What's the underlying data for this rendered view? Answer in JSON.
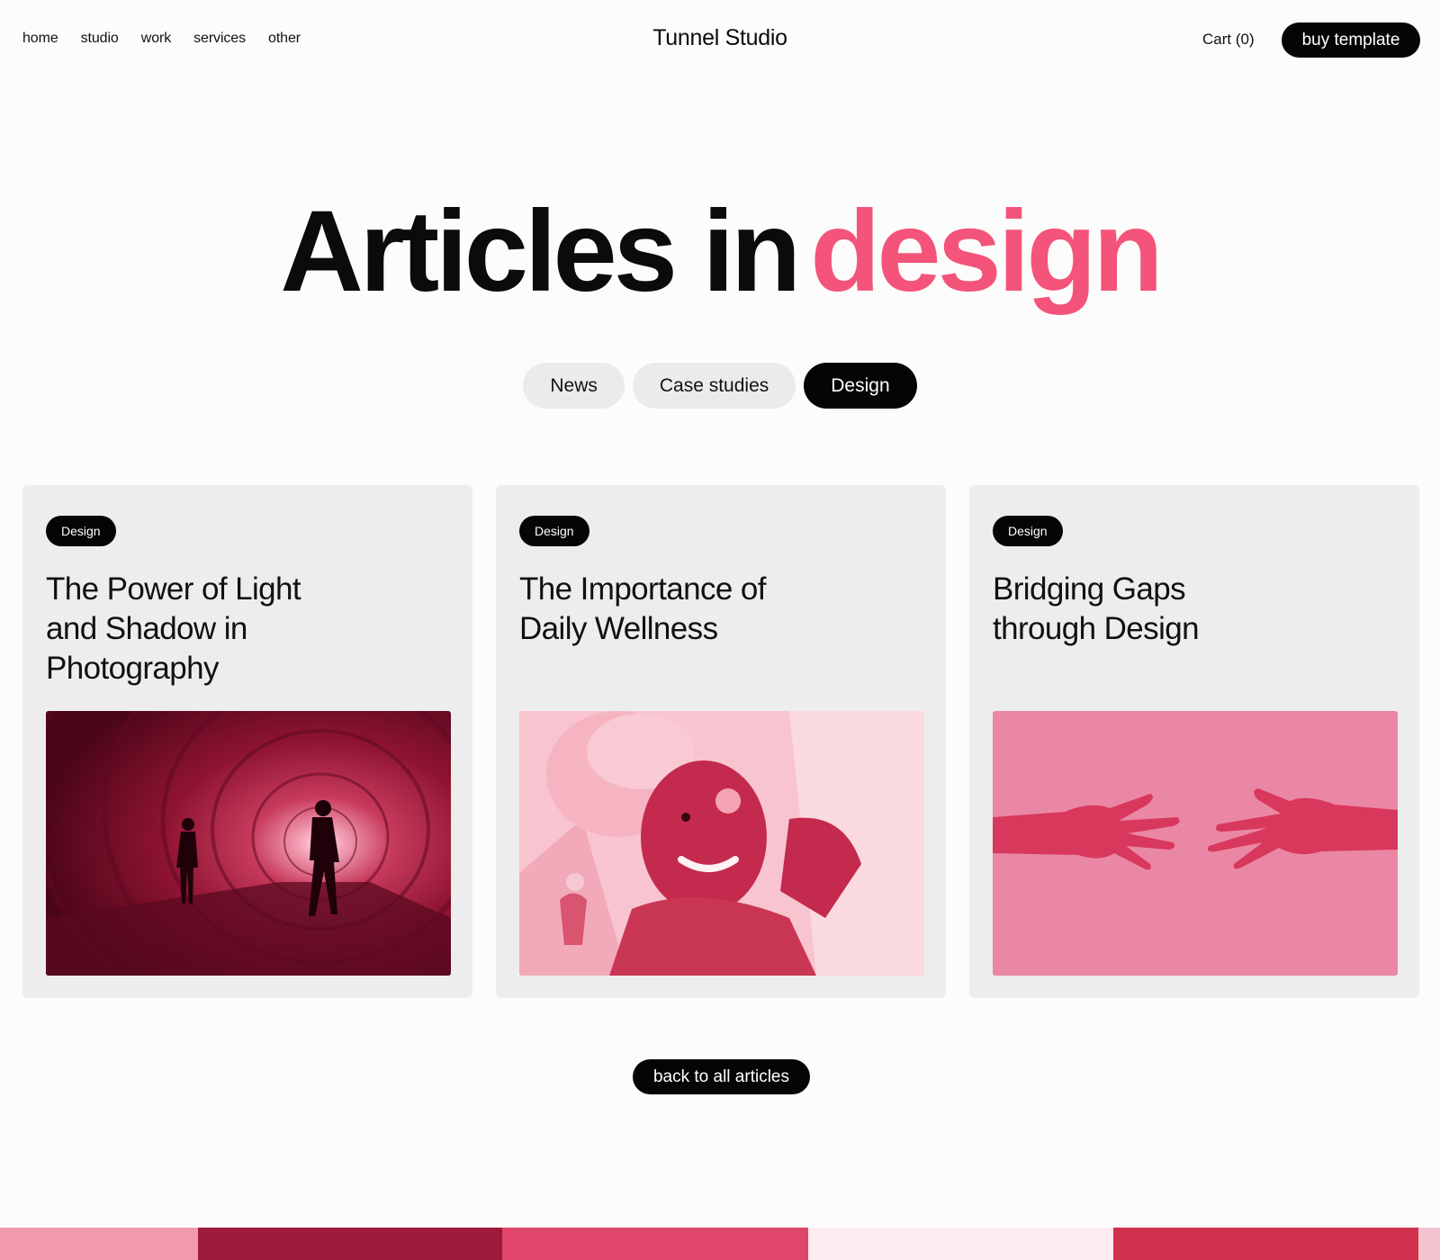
{
  "nav": {
    "items": [
      {
        "label": "home"
      },
      {
        "label": "studio"
      },
      {
        "label": "work"
      },
      {
        "label": "services"
      },
      {
        "label": "other"
      }
    ],
    "brand": "Tunnel Studio",
    "cart": "Cart (0)",
    "buy_label": "buy template"
  },
  "hero": {
    "title_main": "Articles in",
    "title_accent": "design",
    "accent_color": "#f4547a"
  },
  "filters": [
    {
      "label": "News",
      "active": false
    },
    {
      "label": "Case studies",
      "active": false
    },
    {
      "label": "Design",
      "active": true
    }
  ],
  "articles": [
    {
      "tag": "Design",
      "title": "The Power of Light and Shadow in Photography",
      "image": "tunnel-silhouettes-photo"
    },
    {
      "tag": "Design",
      "title": "The Importance of Daily Wellness",
      "image": "woman-skincare-photo"
    },
    {
      "tag": "Design",
      "title": "Bridging Gaps through Design",
      "image": "reaching-hands-photo"
    }
  ],
  "back_label": "back to all articles"
}
